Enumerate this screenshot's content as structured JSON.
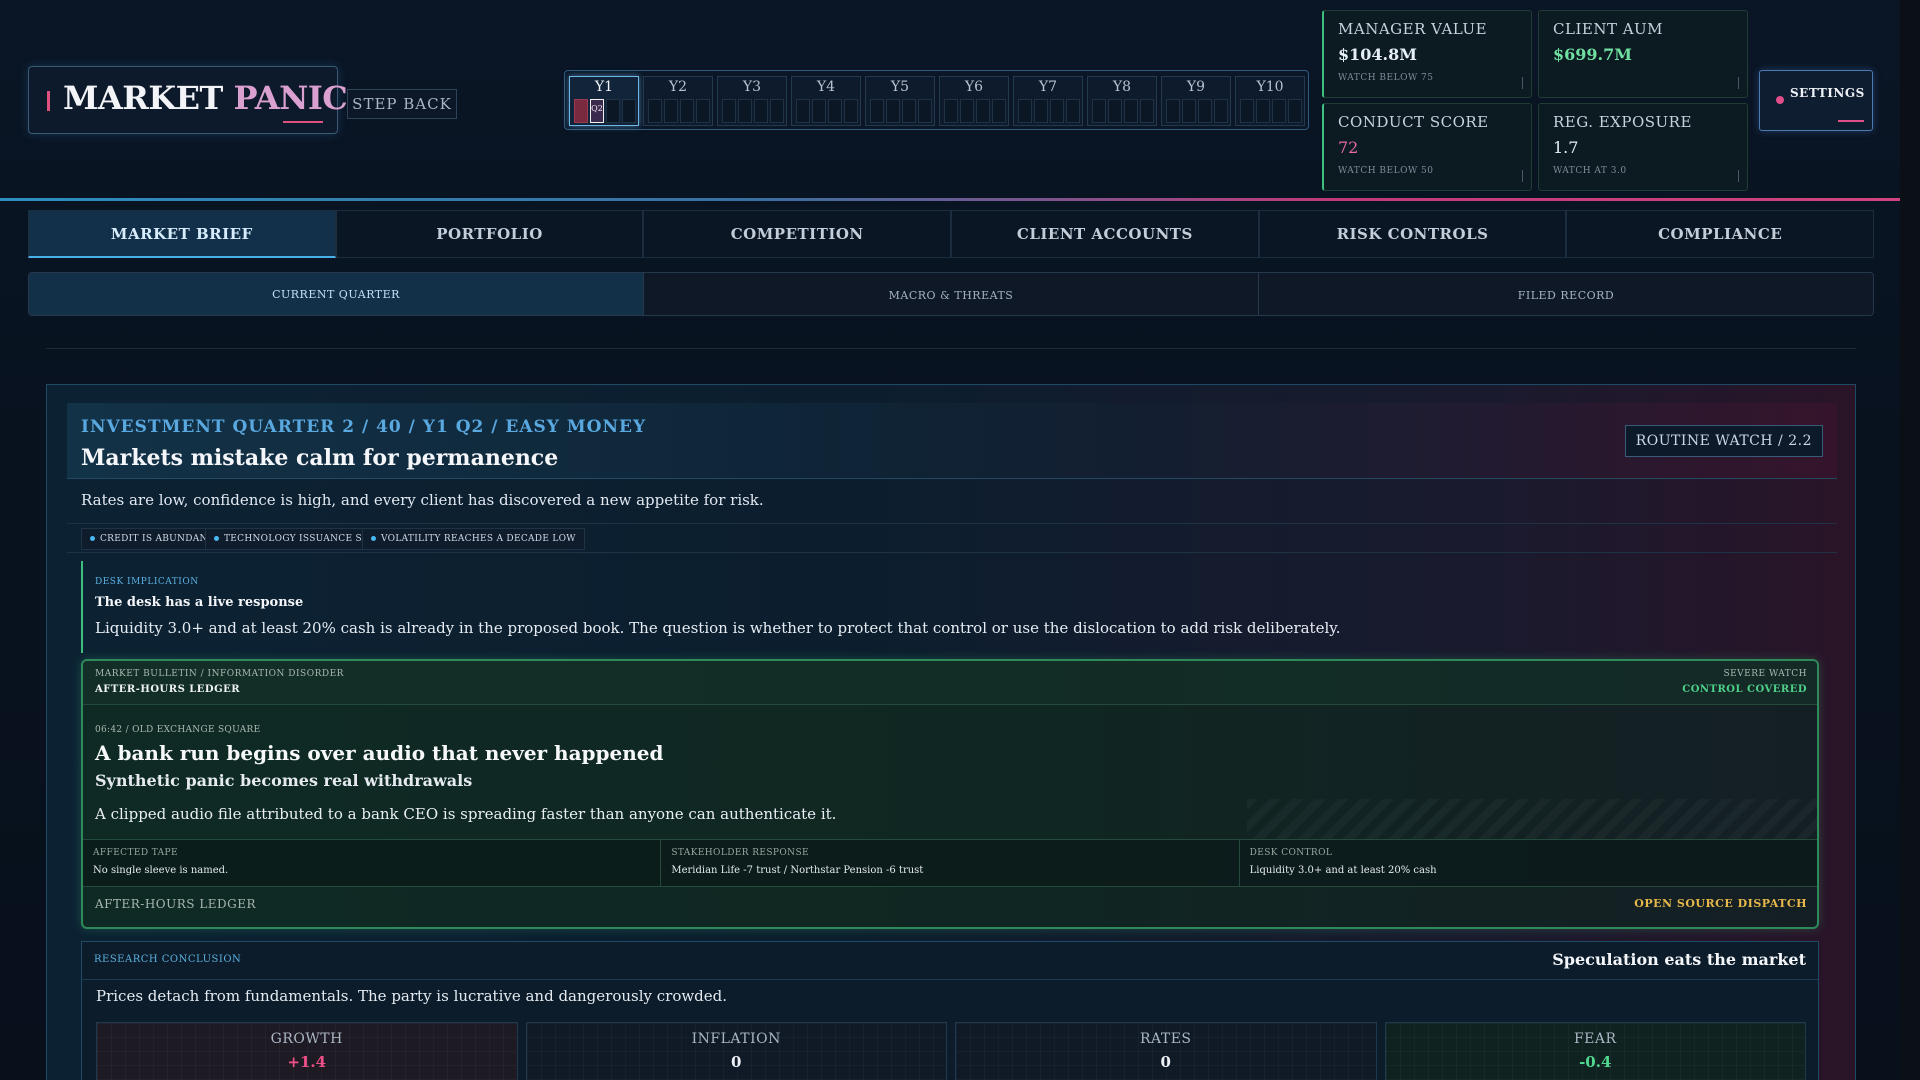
{
  "header": {
    "logo_word1": "MARKET",
    "logo_word2": "PANIC",
    "step_back": "STEP BACK",
    "timeline": {
      "years": [
        "Y1",
        "Y2",
        "Y3",
        "Y4",
        "Y5",
        "Y6",
        "Y7",
        "Y8",
        "Y9",
        "Y10"
      ],
      "active_year": "Y1",
      "current_quarter_label": "Q2"
    },
    "metrics": {
      "manager_value": {
        "title": "MANAGER VALUE",
        "value": "$104.8M",
        "note": "WATCH BELOW 75"
      },
      "client_aum": {
        "title": "CLIENT AUM",
        "value": "$699.7M",
        "note": ""
      },
      "conduct_score": {
        "title": "CONDUCT SCORE",
        "value": "72",
        "note": "WATCH BELOW 50"
      },
      "reg_exposure": {
        "title": "REG. EXPOSURE",
        "value": "1.7",
        "note": "WATCH AT 3.0"
      }
    },
    "settings": "SETTINGS"
  },
  "tabs": [
    "MARKET BRIEF",
    "PORTFOLIO",
    "COMPETITION",
    "CLIENT ACCOUNTS",
    "RISK CONTROLS",
    "COMPLIANCE"
  ],
  "subtabs": [
    "CURRENT QUARTER",
    "MACRO & THREATS",
    "FILED RECORD"
  ],
  "brief": {
    "kicker": "INVESTMENT QUARTER 2 / 40 / Y1 Q2 / EASY MONEY",
    "headline": "Markets mistake calm for permanence",
    "watch_badge": "ROUTINE WATCH / 2.2",
    "lede": "Rates are low, confidence is high, and every client has discovered a new appetite for risk.",
    "tags": [
      "CREDIT IS ABUNDANT",
      "TECHNOLOGY ISSUANCE SURGES",
      "VOLATILITY REACHES A DECADE LOW"
    ],
    "desk": {
      "label": "DESK IMPLICATION",
      "title": "The desk has a live response",
      "body": "Liquidity 3.0+ and at least 20% cash is already in the proposed book. The question is whether to protect that control or use the dislocation to add risk deliberately."
    },
    "bulletin": {
      "kicker": "MARKET BULLETIN / INFORMATION DISORDER",
      "source": "AFTER-HOURS LEDGER",
      "severity": "SEVERE WATCH",
      "control": "CONTROL COVERED",
      "time_place": "06:42 / OLD EXCHANGE SQUARE",
      "title": "A bank run begins over audio that never happened",
      "subtitle": "Synthetic panic becomes real withdrawals",
      "body": "A clipped audio file attributed to a bank CEO is spreading faster than anyone can authenticate it.",
      "cells": [
        {
          "label": "AFFECTED TAPE",
          "value": "No single sleeve is named."
        },
        {
          "label": "STAKEHOLDER RESPONSE",
          "value": "Meridian Life -7 trust / Northstar Pension -6 trust"
        },
        {
          "label": "DESK CONTROL",
          "value": "Liquidity 3.0+ and at least 20% cash"
        }
      ],
      "footer_source": "AFTER-HOURS LEDGER",
      "dispatch": "OPEN SOURCE DISPATCH"
    },
    "research": {
      "label": "RESEARCH CONCLUSION",
      "title": "Speculation eats the market",
      "body": "Prices detach from fundamentals. The party is lucrative and dangerously crowded.",
      "gauges": [
        {
          "label": "GROWTH",
          "value": "+1.4"
        },
        {
          "label": "INFLATION",
          "value": "0"
        },
        {
          "label": "RATES",
          "value": "0"
        },
        {
          "label": "FEAR",
          "value": "-0.4"
        }
      ]
    }
  }
}
